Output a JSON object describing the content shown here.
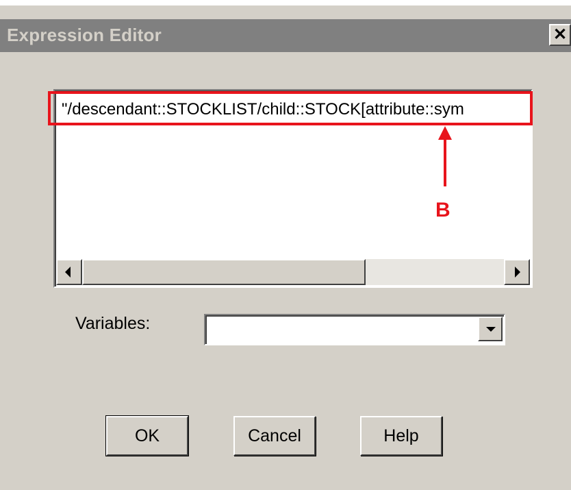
{
  "window": {
    "title": "Expression Editor",
    "close_glyph": "✕"
  },
  "editor": {
    "expression": "\"/descendant::STOCKLIST/child::STOCK[attribute::sym"
  },
  "annotation": {
    "label": "B",
    "color": "#e8141c"
  },
  "variables": {
    "label": "Variables:",
    "value": ""
  },
  "buttons": {
    "ok": "OK",
    "cancel": "Cancel",
    "help": "Help"
  },
  "icons": {
    "close": "close-icon",
    "scroll_left": "scroll-left-icon",
    "scroll_right": "scroll-right-icon",
    "dropdown": "chevron-down-icon"
  }
}
